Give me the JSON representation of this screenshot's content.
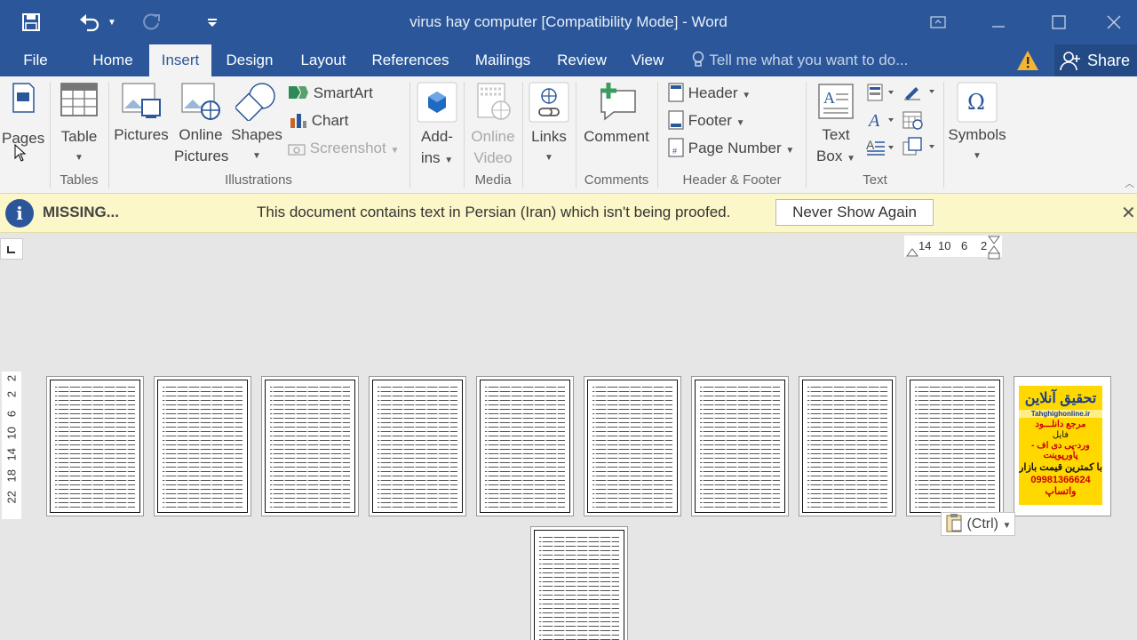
{
  "window": {
    "title": "virus hay computer [Compatibility Mode] - Word"
  },
  "qat": {
    "icons": [
      "save-icon",
      "undo-icon",
      "redo-icon",
      "customize-icon"
    ]
  },
  "tabs": [
    {
      "label": "File"
    },
    {
      "label": "Home"
    },
    {
      "label": "Insert",
      "active": true
    },
    {
      "label": "Design"
    },
    {
      "label": "Layout"
    },
    {
      "label": "References"
    },
    {
      "label": "Mailings"
    },
    {
      "label": "Review"
    },
    {
      "label": "View"
    }
  ],
  "tellme": "Tell me what you want to do...",
  "share": "Share",
  "ribbon": {
    "pages": "Pages",
    "table": "Table",
    "pictures": "Pictures",
    "online_pictures_1": "Online",
    "online_pictures_2": "Pictures",
    "shapes": "Shapes",
    "smartart": "SmartArt",
    "chart": "Chart",
    "screenshot": "Screenshot",
    "addins_1": "Add-",
    "addins_2": "ins",
    "online_video_1": "Online",
    "online_video_2": "Video",
    "links": "Links",
    "comment": "Comment",
    "header": "Header",
    "footer": "Footer",
    "page_number": "Page Number",
    "textbox_1": "Text",
    "textbox_2": "Box",
    "symbols": "Symbols",
    "groups": {
      "tables": "Tables",
      "illustrations": "Illustrations",
      "media": "Media",
      "comments": "Comments",
      "header_footer": "Header & Footer",
      "text": "Text"
    }
  },
  "message_bar": {
    "title": "MISSING...",
    "text": "This document contains text in Persian (Iran) which isn't being proofed.",
    "button": "Never Show Again"
  },
  "hruler": [
    "14",
    "10",
    "6",
    "2"
  ],
  "vruler": [
    "2",
    "2",
    "6",
    "10",
    "14",
    "18",
    "22"
  ],
  "ad_page": {
    "line1": "تحقیق آنلاین",
    "line2": "Tahghighonline.ir",
    "line3": "مرجع دانلـــود",
    "line4": "فایل",
    "line5": "ورد-پی دی اف - پاورپوینت",
    "line6": "با کمترین قیمت بازار",
    "line7": "09981366624 واتساپ"
  },
  "paste_options": "(Ctrl)"
}
